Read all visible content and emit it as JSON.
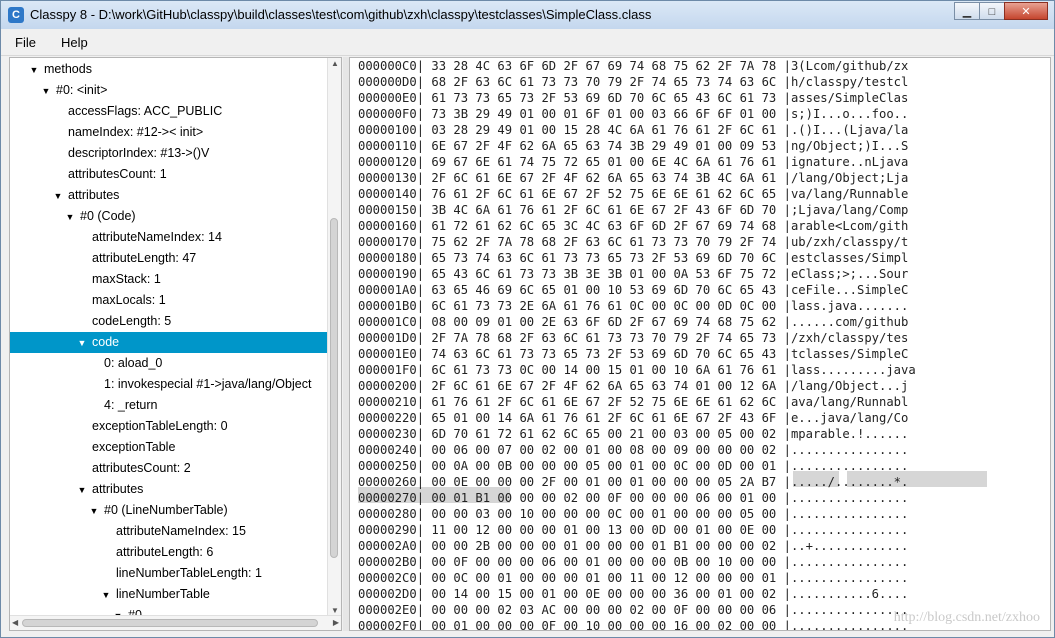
{
  "window": {
    "title": "Classpy 8 - D:\\work\\GitHub\\classpy\\build\\classes\\test\\com\\github\\zxh\\classpy\\testclasses\\SimpleClass.class",
    "icon_letter": "C"
  },
  "window_buttons": {
    "minimize": "▁",
    "maximize": "□",
    "close": "✕"
  },
  "menu": [
    "File",
    "Help"
  ],
  "tree": [
    {
      "depth": 0,
      "expander": "▼",
      "label": "methods"
    },
    {
      "depth": 1,
      "expander": "▼",
      "label": "#0: <init>"
    },
    {
      "depth": 2,
      "expander": "",
      "label": "accessFlags: ACC_PUBLIC"
    },
    {
      "depth": 2,
      "expander": "",
      "label": "nameIndex: #12->< init>"
    },
    {
      "depth": 2,
      "expander": "",
      "label": "descriptorIndex: #13->()V"
    },
    {
      "depth": 2,
      "expander": "",
      "label": "attributesCount: 1"
    },
    {
      "depth": 2,
      "expander": "▼",
      "label": "attributes"
    },
    {
      "depth": 3,
      "expander": "▼",
      "label": "#0 (Code)"
    },
    {
      "depth": 4,
      "expander": "",
      "label": "attributeNameIndex: 14"
    },
    {
      "depth": 4,
      "expander": "",
      "label": "attributeLength: 47"
    },
    {
      "depth": 4,
      "expander": "",
      "label": "maxStack: 1"
    },
    {
      "depth": 4,
      "expander": "",
      "label": "maxLocals: 1"
    },
    {
      "depth": 4,
      "expander": "",
      "label": "codeLength: 5"
    },
    {
      "depth": 4,
      "expander": "▼",
      "label": "code",
      "selected": true
    },
    {
      "depth": 5,
      "expander": "",
      "label": "0: aload_0"
    },
    {
      "depth": 5,
      "expander": "",
      "label": "1: invokespecial #1->java/lang/Object"
    },
    {
      "depth": 5,
      "expander": "",
      "label": "4: _return"
    },
    {
      "depth": 4,
      "expander": "",
      "label": "exceptionTableLength: 0"
    },
    {
      "depth": 4,
      "expander": "",
      "label": "exceptionTable"
    },
    {
      "depth": 4,
      "expander": "",
      "label": "attributesCount: 2"
    },
    {
      "depth": 4,
      "expander": "▼",
      "label": "attributes"
    },
    {
      "depth": 5,
      "expander": "▼",
      "label": "#0 (LineNumberTable)"
    },
    {
      "depth": 6,
      "expander": "",
      "label": "attributeNameIndex: 15"
    },
    {
      "depth": 6,
      "expander": "",
      "label": "attributeLength: 6"
    },
    {
      "depth": 6,
      "expander": "",
      "label": "lineNumberTableLength: 1"
    },
    {
      "depth": 6,
      "expander": "▼",
      "label": "lineNumberTable"
    },
    {
      "depth": 7,
      "expander": "▼",
      "label": "#0"
    }
  ],
  "hex": [
    {
      "addr": "000000C0",
      "bytes": "33 28 4C 63 6F 6D 2F 67 69 74 68 75 62 2F 7A 78",
      "ascii": "3(Lcom/github/zx"
    },
    {
      "addr": "000000D0",
      "bytes": "68 2F 63 6C 61 73 73 70 79 2F 74 65 73 74 63 6C",
      "ascii": "h/classpy/testcl"
    },
    {
      "addr": "000000E0",
      "bytes": "61 73 73 65 73 2F 53 69 6D 70 6C 65 43 6C 61 73",
      "ascii": "asses/SimpleClas"
    },
    {
      "addr": "000000F0",
      "bytes": "73 3B 29 49 01 00 01 6F 01 00 03 66 6F 6F 01 00",
      "ascii": "s;)I...o...foo.."
    },
    {
      "addr": "00000100",
      "bytes": "03 28 29 49 01 00 15 28 4C 6A 61 76 61 2F 6C 61",
      "ascii": ".()I...(Ljava/la"
    },
    {
      "addr": "00000110",
      "bytes": "6E 67 2F 4F 62 6A 65 63 74 3B 29 49 01 00 09 53",
      "ascii": "ng/Object;)I...S"
    },
    {
      "addr": "00000120",
      "bytes": "69 67 6E 61 74 75 72 65 01 00 6E 4C 6A 61 76 61",
      "ascii": "ignature..nLjava"
    },
    {
      "addr": "00000130",
      "bytes": "2F 6C 61 6E 67 2F 4F 62 6A 65 63 74 3B 4C 6A 61",
      "ascii": "/lang/Object;Lja"
    },
    {
      "addr": "00000140",
      "bytes": "76 61 2F 6C 61 6E 67 2F 52 75 6E 6E 61 62 6C 65",
      "ascii": "va/lang/Runnable"
    },
    {
      "addr": "00000150",
      "bytes": "3B 4C 6A 61 76 61 2F 6C 61 6E 67 2F 43 6F 6D 70",
      "ascii": ";Ljava/lang/Comp"
    },
    {
      "addr": "00000160",
      "bytes": "61 72 61 62 6C 65 3C 4C 63 6F 6D 2F 67 69 74 68",
      "ascii": "arable<Lcom/gith"
    },
    {
      "addr": "00000170",
      "bytes": "75 62 2F 7A 78 68 2F 63 6C 61 73 73 70 79 2F 74",
      "ascii": "ub/zxh/classpy/t"
    },
    {
      "addr": "00000180",
      "bytes": "65 73 74 63 6C 61 73 73 65 73 2F 53 69 6D 70 6C",
      "ascii": "estclasses/Simpl"
    },
    {
      "addr": "00000190",
      "bytes": "65 43 6C 61 73 73 3B 3E 3B 01 00 0A 53 6F 75 72",
      "ascii": "eClass;>;...Sour"
    },
    {
      "addr": "000001A0",
      "bytes": "63 65 46 69 6C 65 01 00 10 53 69 6D 70 6C 65 43",
      "ascii": "ceFile...SimpleC"
    },
    {
      "addr": "000001B0",
      "bytes": "6C 61 73 73 2E 6A 61 76 61 0C 00 0C 00 0D 0C 00",
      "ascii": "lass.java......."
    },
    {
      "addr": "000001C0",
      "bytes": "08 00 09 01 00 2E 63 6F 6D 2F 67 69 74 68 75 62",
      "ascii": "......com/github"
    },
    {
      "addr": "000001D0",
      "bytes": "2F 7A 78 68 2F 63 6C 61 73 73 70 79 2F 74 65 73",
      "ascii": "/zxh/classpy/tes"
    },
    {
      "addr": "000001E0",
      "bytes": "74 63 6C 61 73 73 65 73 2F 53 69 6D 70 6C 65 43",
      "ascii": "tclasses/SimpleC"
    },
    {
      "addr": "000001F0",
      "bytes": "6C 61 73 73 0C 00 14 00 15 01 00 10 6A 61 76 61",
      "ascii": "lass.........java"
    },
    {
      "addr": "00000200",
      "bytes": "2F 6C 61 6E 67 2F 4F 62 6A 65 63 74 01 00 12 6A",
      "ascii": "/lang/Object...j"
    },
    {
      "addr": "00000210",
      "bytes": "61 76 61 2F 6C 61 6E 67 2F 52 75 6E 6E 61 62 6C",
      "ascii": "ava/lang/Runnabl"
    },
    {
      "addr": "00000220",
      "bytes": "65 01 00 14 6A 61 76 61 2F 6C 61 6E 67 2F 43 6F",
      "ascii": "e...java/lang/Co"
    },
    {
      "addr": "00000230",
      "bytes": "6D 70 61 72 61 62 6C 65 00 21 00 03 00 05 00 02",
      "ascii": "mparable.!......"
    },
    {
      "addr": "00000240",
      "bytes": "00 06 00 07 00 02 00 01 00 08 00 09 00 00 00 02",
      "ascii": "................"
    },
    {
      "addr": "00000250",
      "bytes": "00 0A 00 0B 00 00 00 05 00 01 00 0C 00 0D 00 01",
      "ascii": "................"
    },
    {
      "addr": "00000260",
      "bytes": "00 0E 00 00 00 2F 00 01 00 01 00 00 00 05 2A B7",
      "ascii": "...../........*."
    },
    {
      "addr": "00000270",
      "bytes": "00 01 B1 00 00 00 02 00 0F 00 00 00 06 00 01 00",
      "ascii": "................"
    },
    {
      "addr": "00000280",
      "bytes": "00 00 03 00 10 00 00 00 0C 00 01 00 00 00 05 00",
      "ascii": "................"
    },
    {
      "addr": "00000290",
      "bytes": "11 00 12 00 00 00 01 00 13 00 0D 00 01 00 0E 00",
      "ascii": "................"
    },
    {
      "addr": "000002A0",
      "bytes": "00 00 2B 00 00 00 01 00 00 00 01 B1 00 00 00 02",
      "ascii": "..+............."
    },
    {
      "addr": "000002B0",
      "bytes": "00 0F 00 00 00 06 00 01 00 00 00 0B 00 10 00 00",
      "ascii": "................"
    },
    {
      "addr": "000002C0",
      "bytes": "00 0C 00 01 00 00 00 01 00 11 00 12 00 00 00 01",
      "ascii": "................"
    },
    {
      "addr": "000002D0",
      "bytes": "00 14 00 15 00 01 00 0E 00 00 00 36 00 01 00 02",
      "ascii": "...........6...."
    },
    {
      "addr": "000002E0",
      "bytes": "00 00 00 02 03 AC 00 00 00 02 00 0F 00 00 00 06",
      "ascii": "................"
    },
    {
      "addr": "000002F0",
      "bytes": "00 01 00 00 00 0F 00 10 00 00 00 16 00 02 00 00",
      "ascii": "................"
    }
  ],
  "watermark": "http://blog.csdn.net/zxhoo"
}
